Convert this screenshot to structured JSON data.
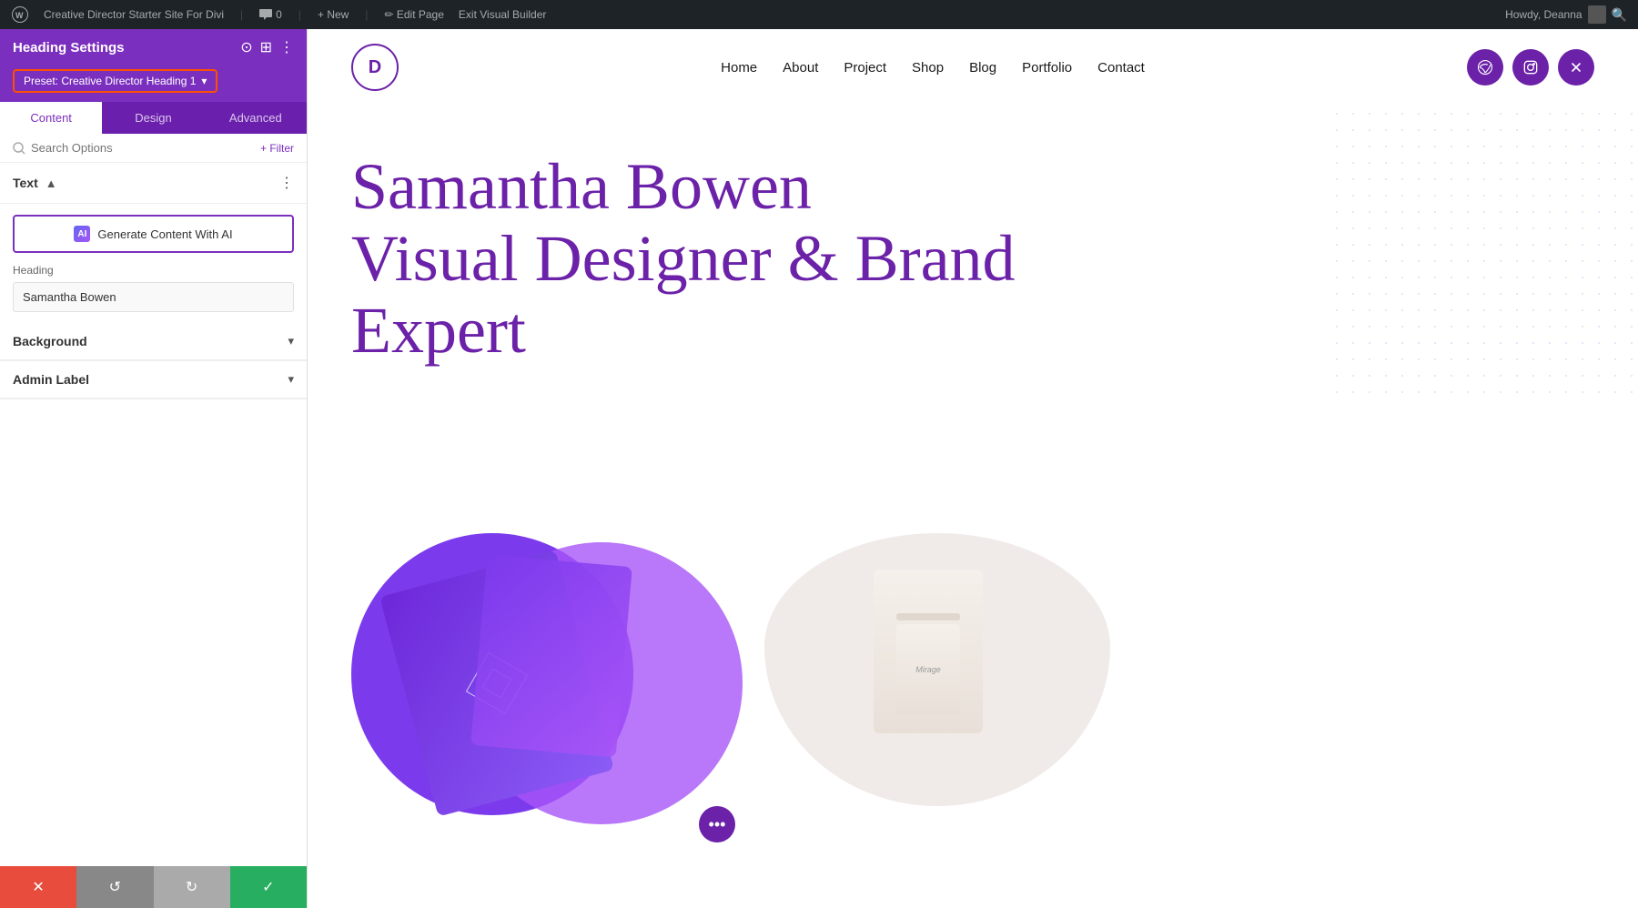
{
  "admin_bar": {
    "wp_icon": "W",
    "site_name": "Creative Director Starter Site For Divi",
    "comments_label": "0",
    "new_label": "New",
    "edit_page_label": "Edit Page",
    "exit_builder_label": "Exit Visual Builder",
    "howdy_label": "Howdy, Deanna",
    "search_icon": "🔍"
  },
  "panel": {
    "title": "Heading Settings",
    "preset_label": "Preset: Creative Director Heading 1",
    "preset_dropdown_icon": "▾",
    "icons": {
      "focus": "⊙",
      "columns": "⊞",
      "dots": "⋮"
    },
    "tabs": [
      {
        "label": "Content",
        "active": true
      },
      {
        "label": "Design",
        "active": false
      },
      {
        "label": "Advanced",
        "active": false
      }
    ],
    "search_placeholder": "Search Options",
    "filter_label": "+ Filter",
    "text_section": {
      "title": "Text",
      "ai_btn_label": "Generate Content With AI",
      "ai_icon_text": "AI",
      "heading_label": "Heading",
      "heading_value": "Samantha Bowen"
    },
    "background_section": {
      "title": "Background"
    },
    "admin_label_section": {
      "title": "Admin Label"
    },
    "bottom_bar": {
      "cancel_icon": "✕",
      "undo_icon": "↺",
      "redo_icon": "↻",
      "save_icon": "✓"
    }
  },
  "site": {
    "logo_letter": "D",
    "nav_links": [
      {
        "label": "Home"
      },
      {
        "label": "About"
      },
      {
        "label": "Project"
      },
      {
        "label": "Shop"
      },
      {
        "label": "Blog"
      },
      {
        "label": "Portfolio"
      },
      {
        "label": "Contact"
      }
    ],
    "social_icons": [
      {
        "name": "dribbble-icon",
        "icon": "⊛"
      },
      {
        "name": "instagram-icon",
        "icon": "◫"
      },
      {
        "name": "twitter-x-icon",
        "icon": "✕"
      }
    ],
    "hero_heading_line1": "Samantha Bowen",
    "hero_heading_line2": "Visual Designer & Brand",
    "hero_heading_line3": "Expert",
    "more_dots": "•••",
    "candle_brand": "Mirage"
  }
}
